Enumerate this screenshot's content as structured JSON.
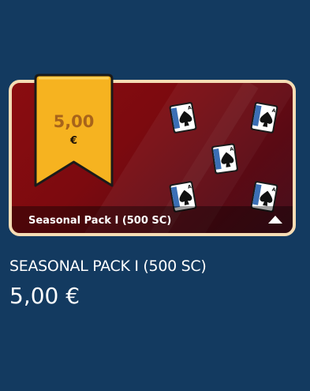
{
  "pack": {
    "ribbon_amount": "5,00",
    "ribbon_currency": "€",
    "footer_label": "Seasonal Pack I (500 SC)",
    "title": "SEASONAL PACK I (500 SC)",
    "price": "5,00 €"
  },
  "icons": {
    "expand": "caret-up-icon",
    "card": "ace-of-spades-card-icon"
  },
  "colors": {
    "background": "#133a60",
    "card_red": "#8a0d10",
    "card_border": "#f6ddb5",
    "ribbon_gold": "#f6b320",
    "ribbon_amount_text": "#a8641a"
  }
}
